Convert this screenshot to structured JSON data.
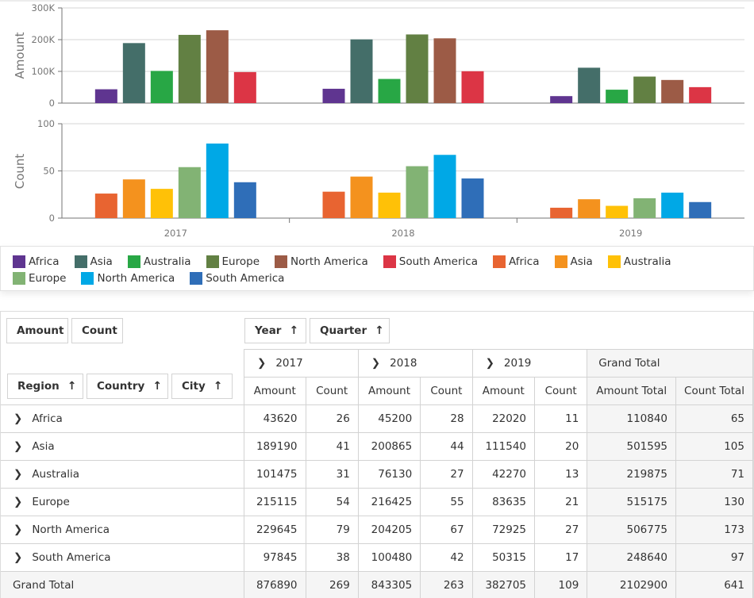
{
  "chart_data": [
    {
      "type": "bar",
      "title": "",
      "xlabel": "",
      "ylabel": "Amount",
      "ylim": [
        0,
        300000
      ],
      "yticks": [
        "0",
        "100K",
        "200K",
        "300K"
      ],
      "ytick_values": [
        0,
        100000,
        200000,
        300000
      ],
      "grid": true,
      "categories": [
        "2017",
        "2018",
        "2019"
      ],
      "series": [
        {
          "name": "Africa",
          "color": "#5f3590",
          "values": [
            43620,
            45200,
            22020
          ]
        },
        {
          "name": "Asia",
          "color": "#446e69",
          "values": [
            189190,
            200865,
            111540
          ]
        },
        {
          "name": "Australia",
          "color": "#28a745",
          "values": [
            101475,
            76130,
            42270
          ]
        },
        {
          "name": "Europe",
          "color": "#628043",
          "values": [
            215115,
            216425,
            83635
          ]
        },
        {
          "name": "North America",
          "color": "#9c5b46",
          "values": [
            229645,
            204205,
            72925
          ]
        },
        {
          "name": "South America",
          "color": "#dc3545",
          "values": [
            97845,
            100480,
            50315
          ]
        }
      ]
    },
    {
      "type": "bar",
      "title": "",
      "xlabel": "",
      "ylabel": "Count",
      "ylim": [
        0,
        100
      ],
      "yticks": [
        "0",
        "50",
        "100"
      ],
      "ytick_values": [
        0,
        50,
        100
      ],
      "grid": true,
      "categories": [
        "2017",
        "2018",
        "2019"
      ],
      "series": [
        {
          "name": "Africa",
          "color": "#e86431",
          "values": [
            26,
            28,
            11
          ]
        },
        {
          "name": "Asia",
          "color": "#f4921e",
          "values": [
            41,
            44,
            20
          ]
        },
        {
          "name": "Australia",
          "color": "#ffc107",
          "values": [
            31,
            27,
            13
          ]
        },
        {
          "name": "Europe",
          "color": "#82b374",
          "values": [
            54,
            55,
            21
          ]
        },
        {
          "name": "North America",
          "color": "#00a8e6",
          "values": [
            79,
            67,
            27
          ]
        },
        {
          "name": "South America",
          "color": "#2f6eb8",
          "values": [
            38,
            42,
            17
          ]
        }
      ]
    }
  ],
  "legend": {
    "placement": "bottom",
    "items": [
      {
        "label": "Africa",
        "color": "#5f3590"
      },
      {
        "label": "Asia",
        "color": "#446e69"
      },
      {
        "label": "Australia",
        "color": "#28a745"
      },
      {
        "label": "Europe",
        "color": "#628043"
      },
      {
        "label": "North America",
        "color": "#9c5b46"
      },
      {
        "label": "South America",
        "color": "#dc3545"
      },
      {
        "label": "Africa",
        "color": "#e86431"
      },
      {
        "label": "Asia",
        "color": "#f4921e"
      },
      {
        "label": "Australia",
        "color": "#ffc107"
      },
      {
        "label": "Europe",
        "color": "#82b374"
      },
      {
        "label": "North America",
        "color": "#00a8e6"
      },
      {
        "label": "South America",
        "color": "#2f6eb8"
      }
    ]
  },
  "pivot": {
    "data_fields": [
      "Amount",
      "Count"
    ],
    "column_fields": [
      "Year",
      "Quarter"
    ],
    "row_fields": [
      "Region",
      "Country",
      "City"
    ],
    "sort_icon": "↑",
    "expand_icon": "›",
    "years": [
      "2017",
      "2018",
      "2019"
    ],
    "grand_total_label": "Grand Total",
    "measure_headers": [
      "Amount",
      "Count",
      "Amount",
      "Count",
      "Amount",
      "Count",
      "Amount Total",
      "Count Total"
    ],
    "rows": [
      {
        "label": "Africa",
        "values": [
          "43620",
          "26",
          "45200",
          "28",
          "22020",
          "11",
          "110840",
          "65"
        ]
      },
      {
        "label": "Asia",
        "values": [
          "189190",
          "41",
          "200865",
          "44",
          "111540",
          "20",
          "501595",
          "105"
        ]
      },
      {
        "label": "Australia",
        "values": [
          "101475",
          "31",
          "76130",
          "27",
          "42270",
          "13",
          "219875",
          "71"
        ]
      },
      {
        "label": "Europe",
        "values": [
          "215115",
          "54",
          "216425",
          "55",
          "83635",
          "21",
          "515175",
          "130"
        ]
      },
      {
        "label": "North America",
        "values": [
          "229645",
          "79",
          "204205",
          "67",
          "72925",
          "27",
          "506775",
          "173"
        ]
      },
      {
        "label": "South America",
        "values": [
          "97845",
          "38",
          "100480",
          "42",
          "50315",
          "17",
          "248640",
          "97"
        ]
      }
    ],
    "grand_total": {
      "label": "Grand Total",
      "values": [
        "876890",
        "269",
        "843305",
        "263",
        "382705",
        "109",
        "2102900",
        "641"
      ]
    }
  }
}
